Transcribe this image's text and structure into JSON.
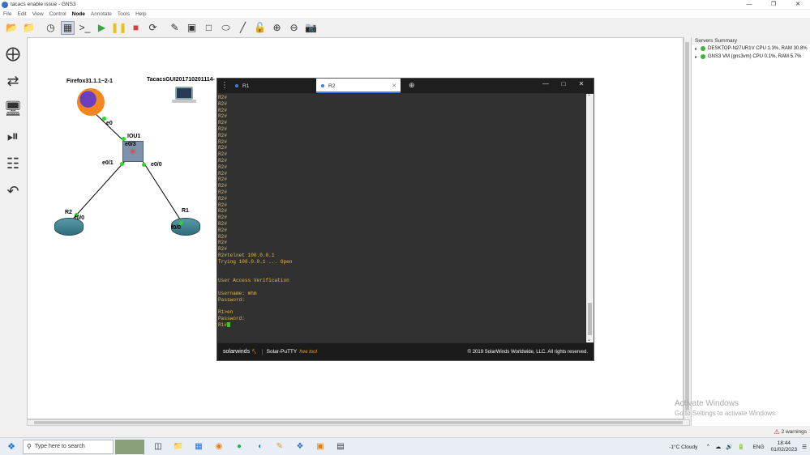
{
  "window": {
    "title": "tacacs enable issue - GNS3",
    "controls": [
      "—",
      "❐",
      "✕"
    ]
  },
  "menu": {
    "items": [
      "File",
      "Edit",
      "View",
      "Control",
      "Node",
      "Annotate",
      "Tools",
      "Help"
    ],
    "active": "Node"
  },
  "toolbar": {
    "icons": [
      "open-folder-icon",
      "open-project-icon",
      "snapshot-icon",
      "show-interfaces-icon",
      "console-icon",
      "start-icon",
      "suspend-icon",
      "stop-icon",
      "reload-icon",
      "edit-note-icon",
      "image-icon",
      "rectangle-icon",
      "ellipse-icon",
      "line-icon",
      "lock-icon",
      "zoom-in-icon",
      "zoom-out-icon",
      "screenshot-icon"
    ]
  },
  "topology": {
    "nodes": [
      {
        "name": "Firefox31.1.1~2-1"
      },
      {
        "name": "TacacsGUI201710201114-"
      },
      {
        "name": "IOU1"
      },
      {
        "name": "R2"
      },
      {
        "name": "R1"
      }
    ],
    "ports": {
      "firefox_e0": "e0",
      "iou_e0_3": "e0/3",
      "iou_e0_1": "e0/1",
      "iou_e0_0": "e0/0",
      "r2_f0_0": "f0/0",
      "r1_f0_0": "f0/0"
    },
    "link_color": "#000000",
    "port_dot_color": "#22dd22"
  },
  "servers": {
    "header": "Servers Summary",
    "rows": [
      {
        "label": "DESKTOP-N27UR1V CPU 1.3%, RAM 30.8%"
      },
      {
        "label": "GNS3 VM (gns3vm) CPU 0.1%, RAM 5.7%"
      }
    ]
  },
  "putty": {
    "tabs": [
      {
        "label": "R1"
      },
      {
        "label": "R2"
      }
    ],
    "terminal_lines": [
      "R2#",
      "R2#",
      "R2#",
      "R2#",
      "R2#",
      "R2#",
      "R2#",
      "R2#",
      "R2#",
      "R2#",
      "R2#",
      "R2#",
      "R2#",
      "R2#",
      "R2#",
      "R2#",
      "R2#",
      "R2#",
      "R2#",
      "R2#",
      "R2#",
      "R2#",
      "R2#",
      "R2#",
      "R2#",
      "R2#telnet 100.0.0.1",
      "Trying 100.0.0.1 ... Open",
      "",
      "",
      "User Access Verification",
      "",
      "Username: mhm",
      "Password:",
      "",
      "R1>en",
      "Password:",
      "R1#"
    ],
    "footer": {
      "brand": "solarwinds",
      "product": "Solar-PuTTY",
      "free": "free tool",
      "copyright": "© 2019 SolarWinds Worldwide, LLC. All rights reserved."
    },
    "text_color": "#e8b64a"
  },
  "watermark": {
    "line1": "Activate Windows",
    "line2": "Go to Settings to activate Windows."
  },
  "status": {
    "warnings": "2 warnings"
  },
  "taskbar": {
    "search_placeholder": "Type here to search",
    "weather": "-1°C  Cloudy",
    "language": "ENG",
    "time": "18:44",
    "date": "01/02/2023"
  }
}
